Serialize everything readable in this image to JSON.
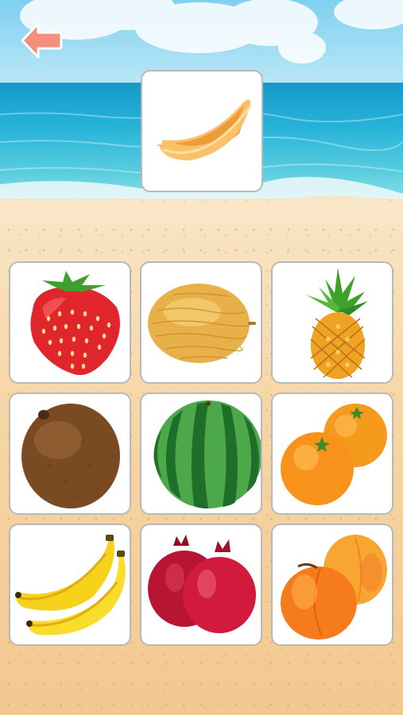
{
  "game": {
    "screen": "fruit-matching",
    "target": {
      "fruit": "melon-slice-icon"
    },
    "choices": [
      {
        "fruit": "strawberry-icon"
      },
      {
        "fruit": "cantaloupe-icon"
      },
      {
        "fruit": "pineapple-icon"
      },
      {
        "fruit": "coconut-icon"
      },
      {
        "fruit": "watermelon-icon"
      },
      {
        "fruit": "oranges-icon"
      },
      {
        "fruit": "bananas-icon"
      },
      {
        "fruit": "pomegranates-icon"
      },
      {
        "fruit": "peaches-icon"
      }
    ]
  },
  "colors": {
    "back_button": "#f48f7d",
    "card_border": "#b9b9b9",
    "sea": "#27b3d8",
    "sand": "#f6d6a6"
  }
}
